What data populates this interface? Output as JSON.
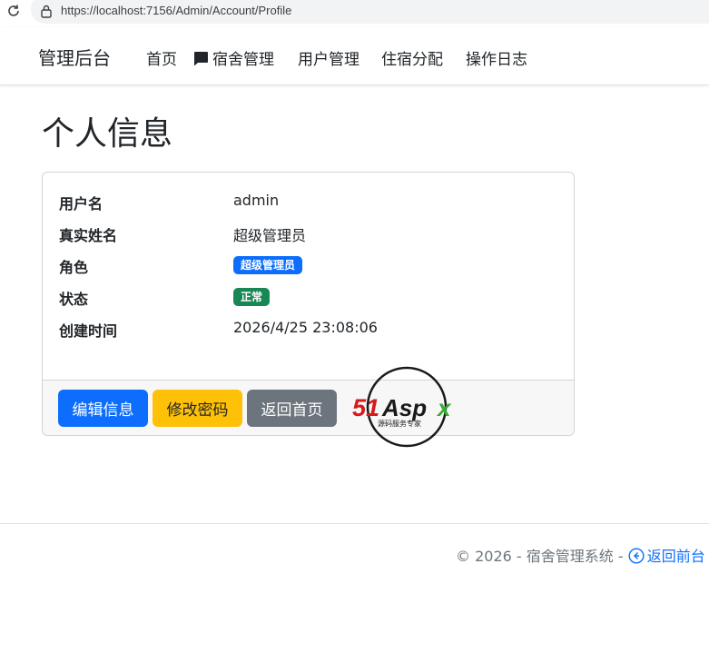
{
  "browser": {
    "url": "https://localhost:7156/Admin/Account/Profile"
  },
  "navbar": {
    "brand": "管理后台",
    "items": [
      {
        "label": "首页"
      },
      {
        "label": "宿舍管理",
        "icon": "chat-bubble-icon"
      },
      {
        "label": "用户管理"
      },
      {
        "label": "住宿分配"
      },
      {
        "label": "操作日志"
      }
    ]
  },
  "page": {
    "title": "个人信息"
  },
  "profile": {
    "username_label": "用户名",
    "username_value": "admin",
    "realname_label": "真实姓名",
    "realname_value": "超级管理员",
    "role_label": "角色",
    "role_value": "超级管理员",
    "status_label": "状态",
    "status_value": "正常",
    "created_label": "创建时间",
    "created_value": "2026/4/25 23:08:06"
  },
  "actions": {
    "edit": "编辑信息",
    "password": "修改密码",
    "home": "返回首页"
  },
  "watermark": {
    "brand": "51Aspx",
    "tagline": "源码服务专家"
  },
  "footer": {
    "copyright": "© 2026 - 宿舍管理系统 - ",
    "link": "返回前台"
  },
  "colors": {
    "primary": "#0d6efd",
    "warning": "#ffc107",
    "secondary": "#6c757d",
    "success": "#198754"
  }
}
